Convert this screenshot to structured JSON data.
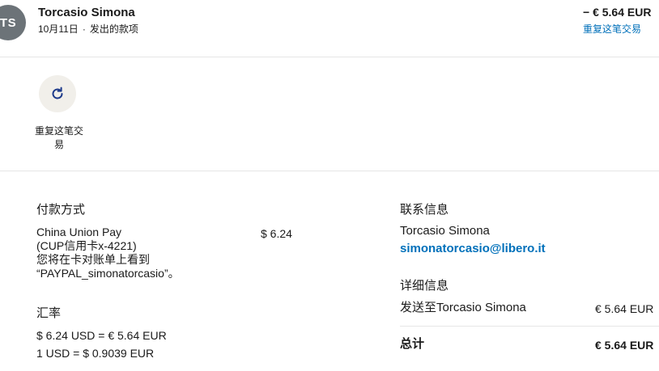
{
  "header": {
    "avatar_initials": "TS",
    "name": "Torcasio Simona",
    "date": "10月11日",
    "separator": "·",
    "type": "发出的款项",
    "amount": "− € 5.64 EUR",
    "repeat_link": "重复这笔交易"
  },
  "actions": {
    "repeat_label": "重复这笔交易",
    "repeat_icon": "refresh-icon"
  },
  "payment": {
    "title": "付款方式",
    "method_line1": "China Union Pay",
    "method_line2": "(CUP信用卡x-4221)",
    "note_line1": "您将在卡对账单上看到",
    "note_line2": "“PAYPAL_simonatorcasio”。",
    "amount": "$ 6.24"
  },
  "exchange": {
    "title": "汇率",
    "line1": "$ 6.24 USD = € 5.64 EUR",
    "line2": "1 USD = $ 0.9039 EUR"
  },
  "contact": {
    "title": "联系信息",
    "name": "Torcasio Simona",
    "email": "simonatorcasio@libero.it"
  },
  "details": {
    "title": "详细信息",
    "sent_to_label": "发送至Torcasio Simona",
    "sent_to_amount": "€ 5.64 EUR",
    "total_label": "总计",
    "total_amount": "€ 5.64 EUR"
  },
  "colors": {
    "link": "#0070ba",
    "avatar_bg": "#6c7378",
    "icon_bg": "#f1efea",
    "icon_stroke": "#1d3a8a"
  }
}
